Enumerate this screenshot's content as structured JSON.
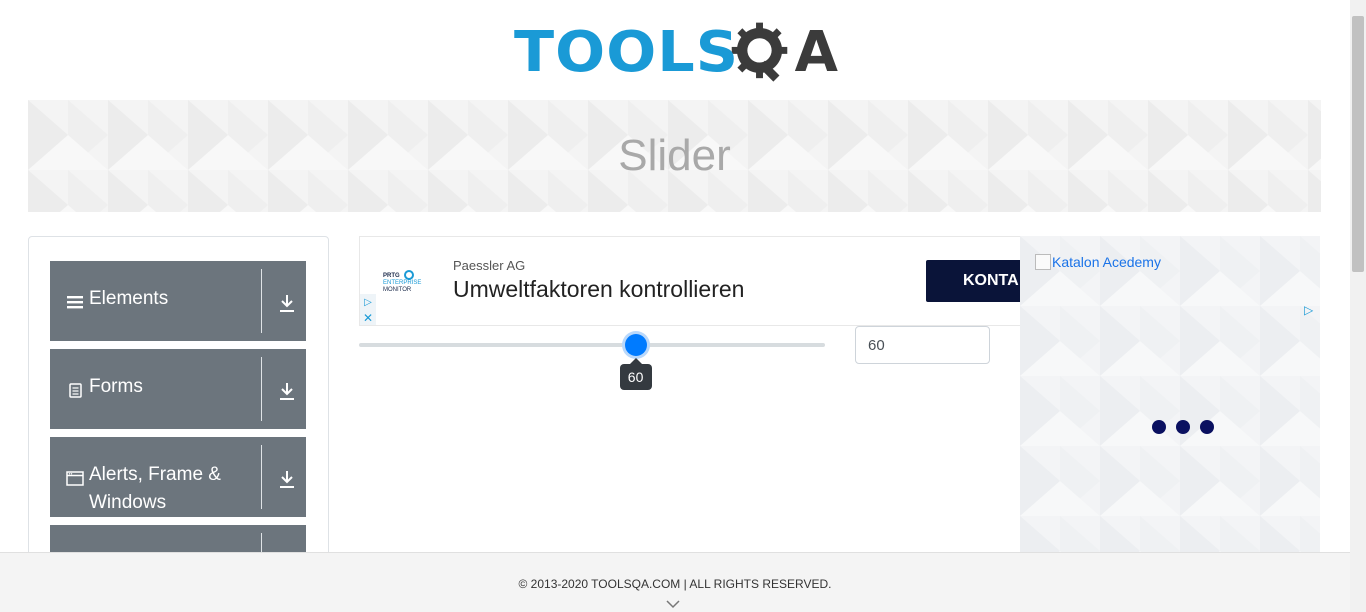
{
  "logo": {
    "text_tools": "TOOLS",
    "text_a": "A",
    "alt": "ToolsQA"
  },
  "banner": {
    "title": "Slider"
  },
  "sidebar": {
    "groups": [
      {
        "label": "Elements",
        "icon": "hamburger-icon"
      },
      {
        "label": "Forms",
        "icon": "document-icon"
      },
      {
        "label": "Alerts, Frame & Windows",
        "icon": "window-icon"
      },
      {
        "label": "",
        "icon": ""
      }
    ]
  },
  "ad": {
    "logo_text": "PRTG ENTERPRISE MONITOR",
    "sponsor": "Paessler AG",
    "headline": "Umweltfaktoren kontrollieren",
    "cta": "KONTA",
    "adchoice": "▷",
    "close": "✕"
  },
  "slider": {
    "value": 60,
    "min": 0,
    "max": 100,
    "tooltip": "60",
    "input_value": "60"
  },
  "side_ad": {
    "image_alt": "Katalon Acedemy",
    "adchoice": "▷",
    "close": "✕"
  },
  "footer": {
    "copyright": "© 2013-2020 TOOLSQA.COM | ALL RIGHTS RESERVED."
  },
  "colors": {
    "brand_blue": "#1a9ad6",
    "brand_dark": "#3b3b3b",
    "sidebar_group": "#6c757d",
    "slider_accent": "#007bff",
    "cta_bg": "#0a1439"
  }
}
